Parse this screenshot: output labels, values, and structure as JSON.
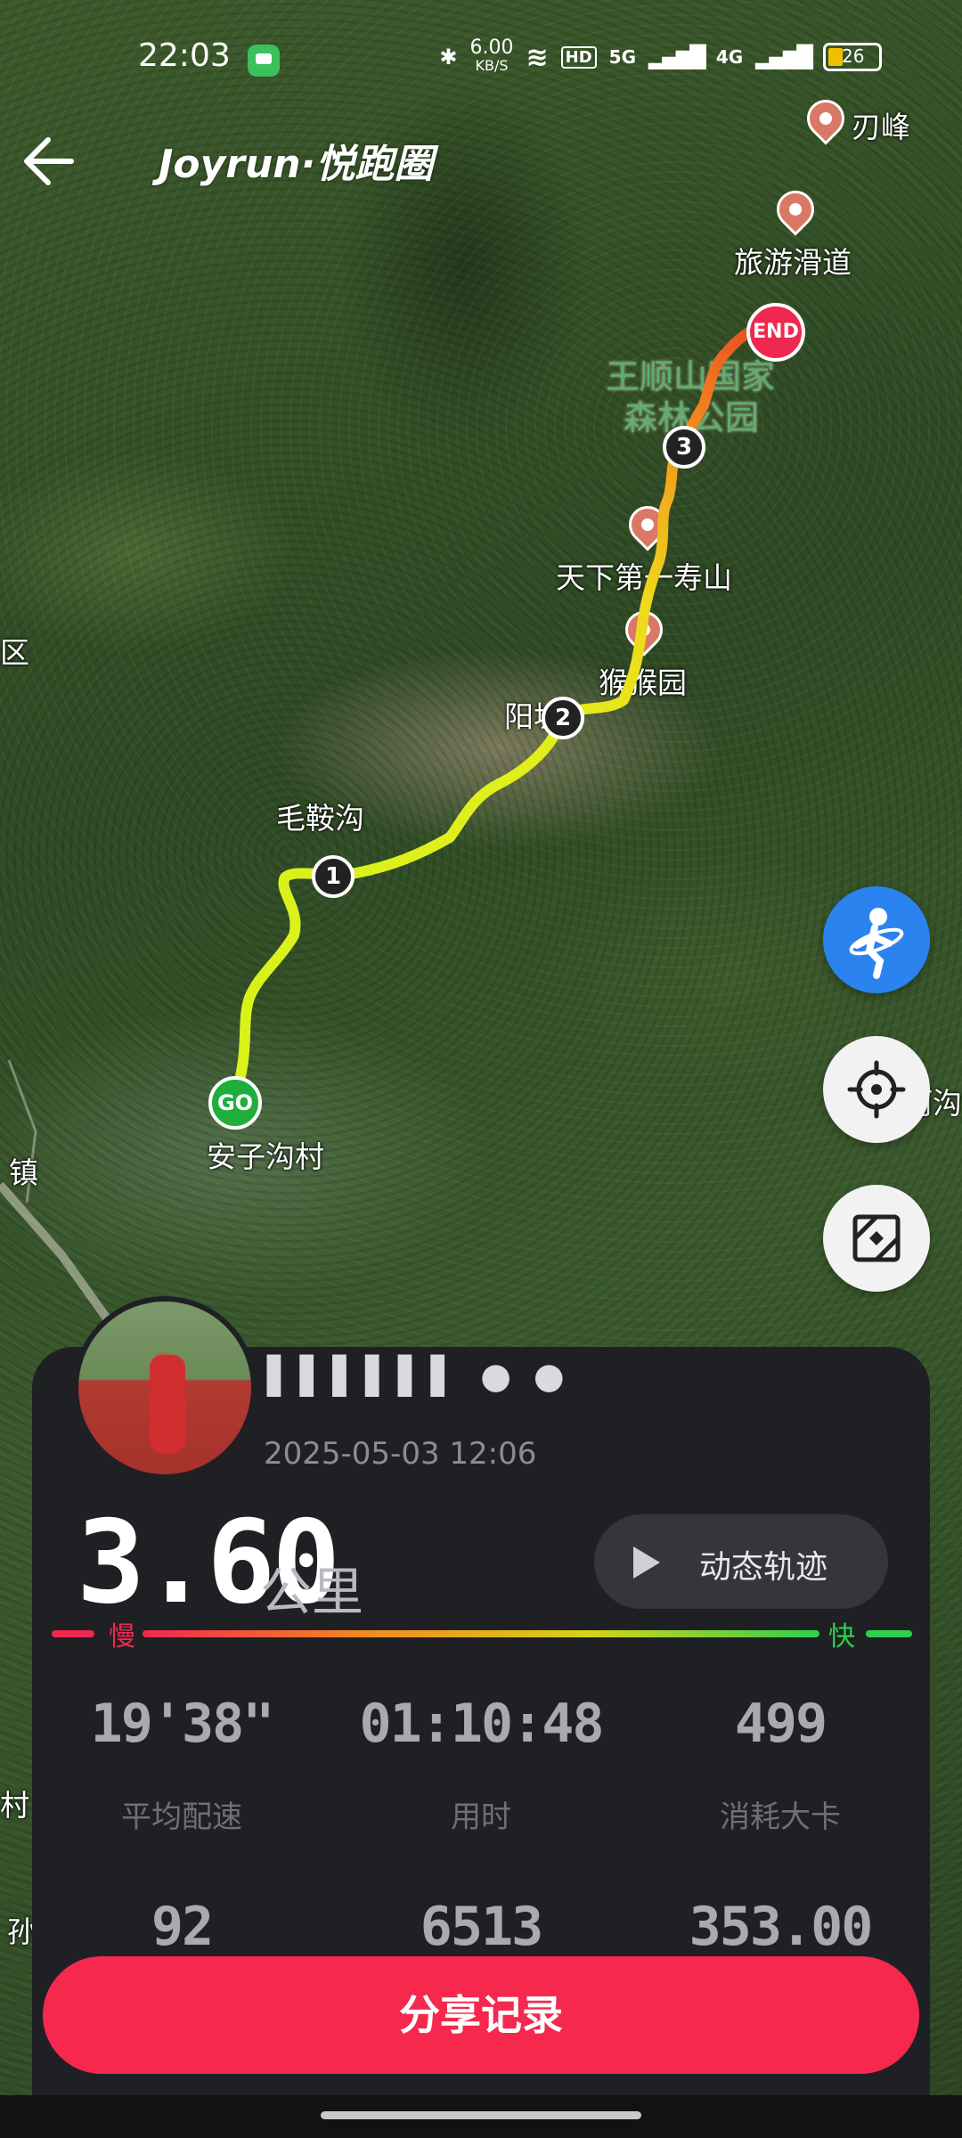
{
  "status_bar": {
    "time": "22:03",
    "net_speed": "6.00",
    "net_unit": "KB/S",
    "hd": "HD",
    "signal_1": "5G",
    "signal_2": "4G",
    "battery": "26"
  },
  "header": {
    "logo": "Joyrun·悦跑圈",
    "back_icon": "arrow-left-icon"
  },
  "map": {
    "labels": {
      "poi_top": "刃峰",
      "poi_slide": "旅游滑道",
      "park_line1": "王顺山国家",
      "park_line2": "森林公园",
      "poi_shoushan": "天下第一寿山",
      "poi_monkey": "猴猴园",
      "village_yang": "阳坡",
      "village_maoan": "毛鞍沟",
      "village_start": "安子沟村",
      "edge_left_1": "区",
      "edge_left_2": "镇",
      "edge_left_3": "村",
      "edge_left_4": "孙",
      "edge_right": "河沟"
    },
    "markers": {
      "go": "GO",
      "end": "END",
      "km1": "1",
      "km2": "2",
      "km3": "3"
    }
  },
  "fabs": {
    "mode_icon": "runner-icon",
    "locate_icon": "crosshair-icon",
    "expand_icon": "expand-icon"
  },
  "panel": {
    "user_name": "▌▌▌▌▌▌ ● ●",
    "date": "2025-05-03 12:06",
    "distance": "3.60",
    "distance_unit": "公里",
    "replay_label": "动态轨迹",
    "pace_slow": "慢",
    "pace_fast": "快",
    "pace_colors": [
      "#ef2850",
      "#f58a1f",
      "#d6d21a",
      "#2ed04d"
    ],
    "stats_row1": [
      {
        "value": "19'38\"",
        "label": "平均配速"
      },
      {
        "value": "01:10:48",
        "label": "用时"
      },
      {
        "value": "499",
        "label": "消耗大卡"
      }
    ],
    "stats_row2": [
      {
        "value": "92"
      },
      {
        "value": "6513"
      },
      {
        "value": "353.00"
      }
    ],
    "share_label": "分享记录"
  }
}
